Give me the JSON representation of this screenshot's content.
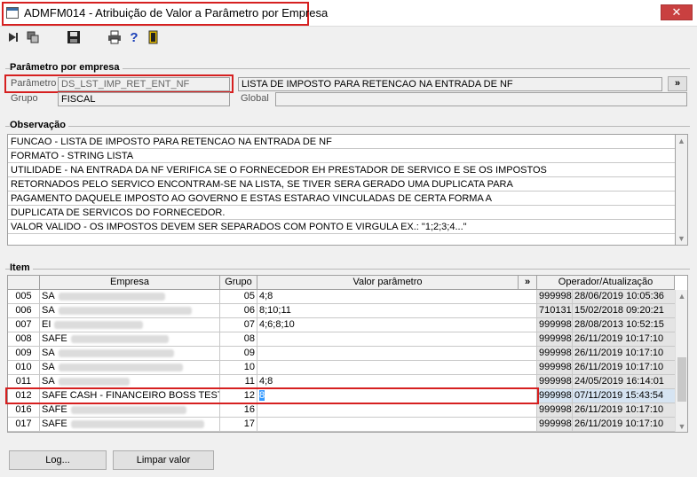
{
  "window": {
    "title": "ADMFM014 - Atribuição de Valor a Parâmetro por Empresa",
    "close_symbol": "✕"
  },
  "toolbar": {
    "icons": [
      "first-icon",
      "copy-icon",
      "save-icon",
      "print-icon",
      "help-icon",
      "exit-icon"
    ],
    "help_symbol": "?"
  },
  "parametro": {
    "section_title": "Parâmetro por empresa",
    "parametro_label": "Parâmetro",
    "parametro_value": "DS_LST_IMP_RET_ENT_NF",
    "descricao": "LISTA DE IMPOSTO PARA RETENCAO NA ENTRADA DE NF",
    "expand_label": "»",
    "grupo_label": "Grupo",
    "grupo_value": "FISCAL",
    "global_label": "Global",
    "global_value": ""
  },
  "observacao": {
    "section_title": "Observação",
    "lines": [
      "FUNCAO - LISTA DE IMPOSTO PARA RETENCAO NA ENTRADA DE NF",
      "FORMATO - STRING LISTA",
      "UTILIDADE - NA ENTRADA DA NF VERIFICA SE O FORNECEDOR EH PRESTADOR DE SERVICO E SE OS IMPOSTOS",
      "RETORNADOS PELO SERVICO ENCONTRAM-SE NA LISTA, SE TIVER SERA GERADO UMA DUPLICATA PARA",
      "PAGAMENTO DAQUELE IMPOSTO AO GOVERNO E ESTAS ESTARAO VINCULADAS DE CERTA FORMA A",
      "DUPLICATA DE SERVICOS DO FORNECEDOR.",
      "VALOR VALIDO - OS IMPOSTOS DEVEM SER SEPARADOS COM PONTO E VIRGULA EX.: \"1;2;3;4...\""
    ]
  },
  "item": {
    "section_title": "Item",
    "columns": {
      "empresa": "Empresa",
      "grupo": "Grupo",
      "valor": "Valor parâmetro",
      "expand": "»",
      "operador": "Operador/Atualização"
    },
    "rows": [
      {
        "code": "005",
        "empresa": "SA",
        "grupo": "05",
        "valor": "4;8",
        "operador": "999998",
        "data": "28/06/2019 10:05:36"
      },
      {
        "code": "006",
        "empresa": "SA",
        "grupo": "06",
        "valor": "8;10;11",
        "operador": "710131",
        "data": "15/02/2018 09:20:21"
      },
      {
        "code": "007",
        "empresa": "EI",
        "grupo": "07",
        "valor": "4;6;8;10",
        "operador": "999998",
        "data": "28/08/2013 10:52:15"
      },
      {
        "code": "008",
        "empresa": "SAFE",
        "grupo": "08",
        "valor": "",
        "operador": "999998",
        "data": "26/11/2019 10:17:10"
      },
      {
        "code": "009",
        "empresa": "SA",
        "grupo": "09",
        "valor": "",
        "operador": "999998",
        "data": "26/11/2019 10:17:10"
      },
      {
        "code": "010",
        "empresa": "SA",
        "grupo": "10",
        "valor": "",
        "operador": "999998",
        "data": "26/11/2019 10:17:10"
      },
      {
        "code": "011",
        "empresa": "SA",
        "grupo": "11",
        "valor": "4;8",
        "operador": "999998",
        "data": "24/05/2019 16:14:01"
      },
      {
        "code": "012",
        "empresa": "SAFE CASH - FINANCEIRO BOSS TESTE",
        "grupo": "12",
        "valor": "8",
        "operador": "999998",
        "data": "07/11/2019 15:43:54"
      },
      {
        "code": "016",
        "empresa": "SAFE",
        "grupo": "16",
        "valor": "",
        "operador": "999998",
        "data": "26/11/2019 10:17:10"
      },
      {
        "code": "017",
        "empresa": "SAFE",
        "grupo": "17",
        "valor": "",
        "operador": "999998",
        "data": "26/11/2019 10:17:10"
      }
    ]
  },
  "buttons": {
    "log": "Log...",
    "limpar": "Limpar valor"
  }
}
